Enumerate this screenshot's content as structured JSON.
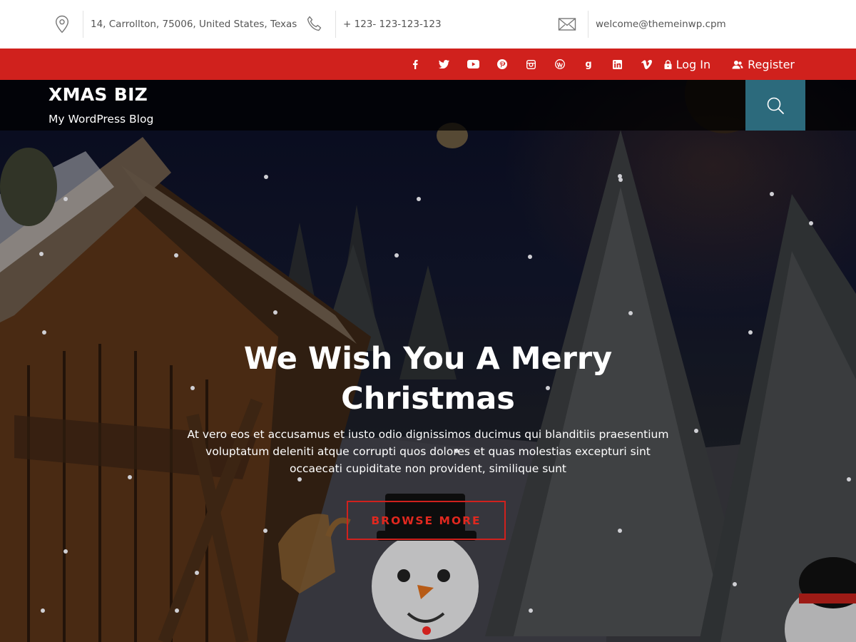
{
  "topbar": {
    "address": "14, Carrollton, 75006, United States, Texas",
    "phone": "+ 123- 123-123-123",
    "email": "welcome@themeinwp.cpm"
  },
  "social": {
    "icons": [
      "facebook-icon",
      "twitter-icon",
      "youtube-icon",
      "pinterest-icon",
      "instagram-icon",
      "wordpress-icon",
      "google-icon",
      "linkedin-icon",
      "vimeo-icon"
    ],
    "login_label": "Log In",
    "register_label": "Register"
  },
  "header": {
    "site_title": "XMAS BIZ",
    "tagline": "My WordPress Blog"
  },
  "hero": {
    "title": "We Wish You A Merry Christmas",
    "text": "At vero eos et accusamus et iusto odio dignissimos ducimus qui blanditiis praesentium voluptatum deleniti atque corrupti quos dolores et quas molestias excepturi sint occaecati cupiditate non provident, similique sunt",
    "button_label": "BROWSE MORE"
  },
  "colors": {
    "accent_red": "#d0211d",
    "search_teal": "#2c6a7c"
  }
}
